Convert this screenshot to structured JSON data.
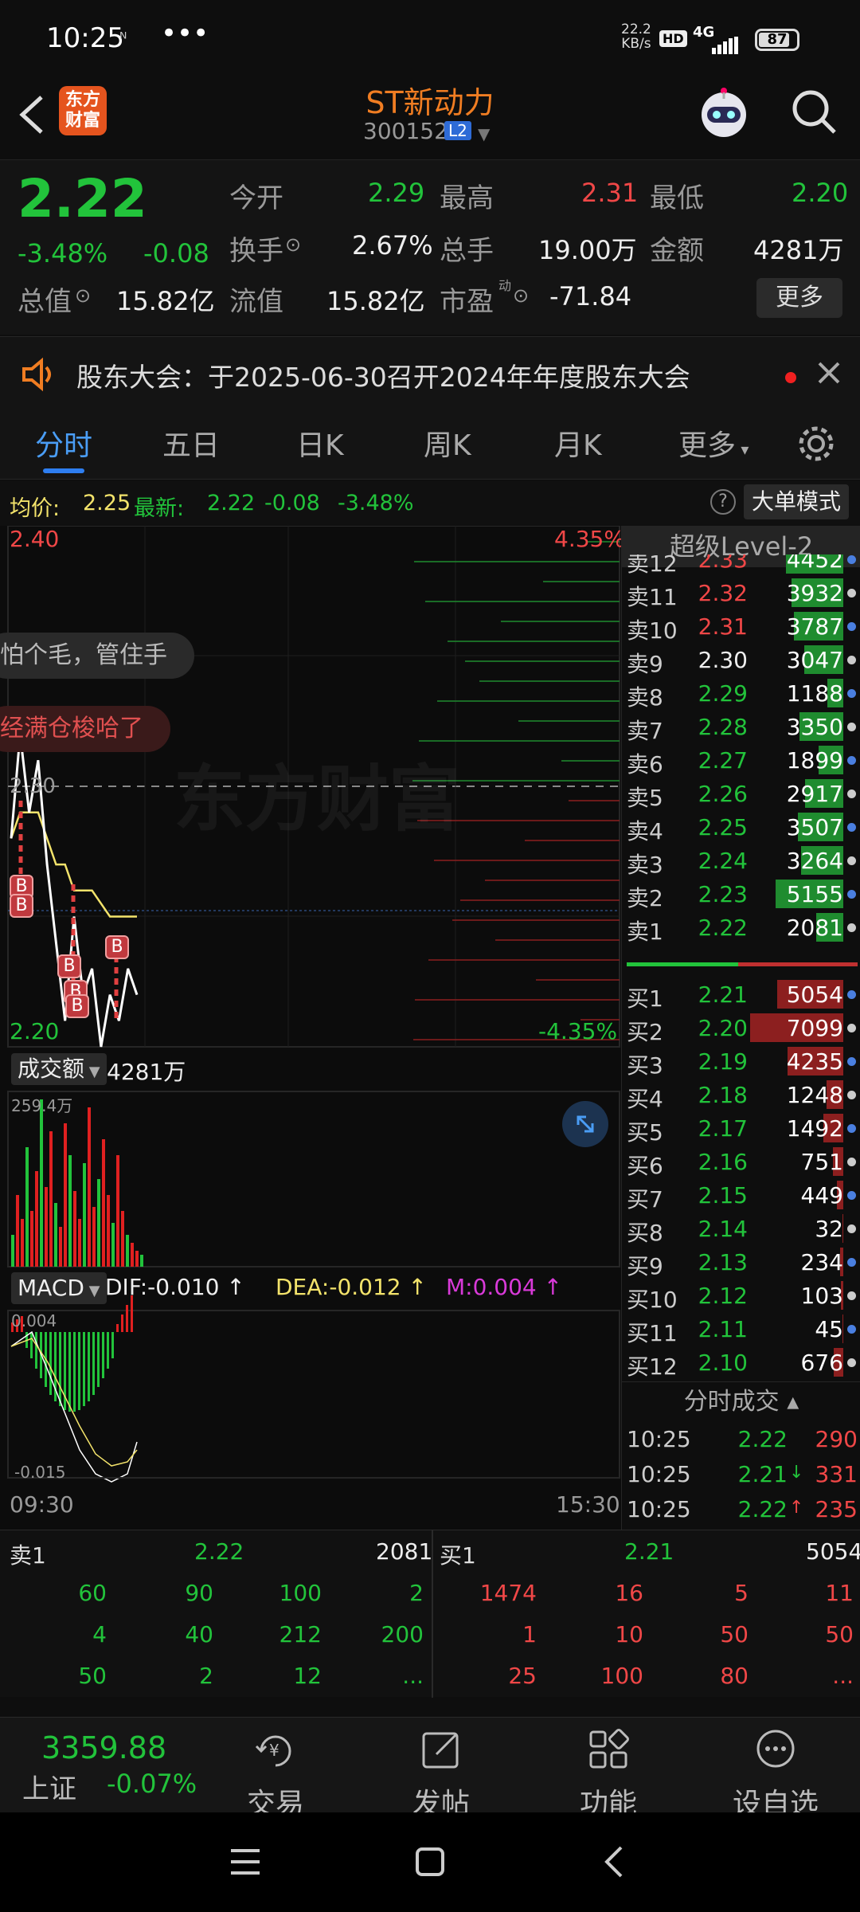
{
  "status_bar": {
    "time": "10:25",
    "net_speed_value": "22.2",
    "net_speed_unit": "KB/s",
    "hd": "HD",
    "network": "4G",
    "battery": "87"
  },
  "header": {
    "app_badge": "东方财富",
    "stock_name": "ST新动力",
    "stock_code": "300152",
    "level_badge": "L2"
  },
  "quote": {
    "price": "2.22",
    "change_pct": "-3.48%",
    "change": "-0.08",
    "open_label": "今开",
    "open": "2.29",
    "high_label": "最高",
    "high": "2.31",
    "low_label": "最低",
    "low": "2.20",
    "turnover_label": "换手",
    "turnover": "2.67%",
    "volume_label": "总手",
    "volume": "19.00万",
    "amount_label": "金额",
    "amount": "4281万",
    "total_cap_label": "总值",
    "total_cap": "15.82亿",
    "float_cap_label": "流值",
    "float_cap": "15.82亿",
    "pe_label": "市盈",
    "pe_sup": "动",
    "pe": "-71.84",
    "more_button": "更多"
  },
  "notice": {
    "text": "股东大会：于2025-06-30召开2024年年度股东大会"
  },
  "tabs": [
    "分时",
    "五日",
    "日K",
    "周K",
    "月K",
    "更多"
  ],
  "avg_bar": {
    "avg_label": "均价:",
    "avg": "2.25",
    "latest_label": "最新:",
    "latest": "2.22",
    "change": "-0.08",
    "change_pct": "-3.48%",
    "mode_button": "大单模式"
  },
  "chart": {
    "y_top": "2.40",
    "y_bottom": "2.20",
    "y_mid": "2.30",
    "pct_top": "4.35%",
    "pct_bottom": "-4.35%",
    "watermark": "东方财富",
    "danmaku": [
      "怕个毛，管住手",
      "经满仓梭哈了"
    ],
    "trade_markers": [
      "B",
      "B",
      "B",
      "B",
      "B",
      "B"
    ],
    "volume_label": "成交额",
    "volume_value": "4281万",
    "volume_max": "259.4万",
    "macd_label": "MACD",
    "dif": "DIF:-0.010",
    "dea": "DEA:-0.012",
    "m": "M:0.004",
    "macd_top": "0.004",
    "macd_bottom": "-0.015",
    "time_start": "09:30",
    "time_end": "15:30"
  },
  "chart_data": {
    "type": "line",
    "title": "",
    "ylim": [
      2.2,
      2.4
    ],
    "series": [
      {
        "name": "",
        "values": [
          2.28,
          2.32,
          2.29,
          2.31,
          2.27,
          2.24,
          2.21,
          2.25,
          2.22,
          2.23,
          2.2,
          2.22,
          2.21,
          2.23,
          2.22
        ]
      },
      {
        "name": "",
        "values": [
          2.28,
          2.29,
          2.29,
          2.29,
          2.28,
          2.27,
          2.27,
          2.26,
          2.26,
          2.26,
          2.255,
          2.25,
          2.25,
          2.25,
          2.25
        ]
      }
    ]
  },
  "book": {
    "header": "超级Level-2",
    "sells": [
      {
        "label": "卖12",
        "price": "2.33",
        "vol": "4452",
        "fill": 0.55
      },
      {
        "label": "卖11",
        "price": "2.32",
        "vol": "3932",
        "fill": 0.5
      },
      {
        "label": "卖10",
        "price": "2.31",
        "vol": "3787",
        "fill": 0.48
      },
      {
        "label": "卖9",
        "price": "2.30",
        "vol": "3047",
        "fill": 0.38
      },
      {
        "label": "卖8",
        "price": "2.29",
        "vol": "1188",
        "fill": 0.15
      },
      {
        "label": "卖7",
        "price": "2.28",
        "vol": "3350",
        "fill": 0.42
      },
      {
        "label": "卖6",
        "price": "2.27",
        "vol": "1899",
        "fill": 0.24
      },
      {
        "label": "卖5",
        "price": "2.26",
        "vol": "2917",
        "fill": 0.37
      },
      {
        "label": "卖4",
        "price": "2.25",
        "vol": "3507",
        "fill": 0.44
      },
      {
        "label": "卖3",
        "price": "2.24",
        "vol": "3264",
        "fill": 0.41
      },
      {
        "label": "卖2",
        "price": "2.23",
        "vol": "5155",
        "fill": 0.65
      },
      {
        "label": "卖1",
        "price": "2.22",
        "vol": "2081",
        "fill": 0.26
      }
    ],
    "buys": [
      {
        "label": "买1",
        "price": "2.21",
        "vol": "5054",
        "fill": 0.64
      },
      {
        "label": "买2",
        "price": "2.20",
        "vol": "7099",
        "fill": 0.9
      },
      {
        "label": "买3",
        "price": "2.19",
        "vol": "4235",
        "fill": 0.54
      },
      {
        "label": "买4",
        "price": "2.18",
        "vol": "1248",
        "fill": 0.16
      },
      {
        "label": "买5",
        "price": "2.17",
        "vol": "1492",
        "fill": 0.19
      },
      {
        "label": "买6",
        "price": "2.16",
        "vol": "751",
        "fill": 0.1
      },
      {
        "label": "买7",
        "price": "2.15",
        "vol": "449",
        "fill": 0.06
      },
      {
        "label": "买8",
        "price": "2.14",
        "vol": "32",
        "fill": 0.01
      },
      {
        "label": "买9",
        "price": "2.13",
        "vol": "234",
        "fill": 0.03
      },
      {
        "label": "买10",
        "price": "2.12",
        "vol": "103",
        "fill": 0.02
      },
      {
        "label": "买11",
        "price": "2.11",
        "vol": "45",
        "fill": 0.01
      },
      {
        "label": "买12",
        "price": "2.10",
        "vol": "676",
        "fill": 0.09
      }
    ],
    "ticks_header": "分时成交",
    "ticks": [
      {
        "time": "10:25",
        "price": "2.22",
        "arrow": "",
        "vol": "290"
      },
      {
        "time": "10:25",
        "price": "2.21",
        "arrow": "↓",
        "vol": "331"
      },
      {
        "time": "10:25",
        "price": "2.22",
        "arrow": "↑",
        "vol": "235"
      }
    ]
  },
  "bottom_table": {
    "sell_label": "卖1",
    "sell_price": "2.22",
    "sell_vol": "2081",
    "buy_label": "买1",
    "buy_price": "2.21",
    "buy_vol": "5054",
    "sell_rows": [
      [
        "60",
        "90",
        "100",
        "2"
      ],
      [
        "4",
        "40",
        "212",
        "200"
      ],
      [
        "50",
        "2",
        "12",
        "..."
      ]
    ],
    "buy_rows": [
      [
        "1474",
        "16",
        "5",
        "11"
      ],
      [
        "1",
        "10",
        "50",
        "50"
      ],
      [
        "25",
        "100",
        "80",
        "..."
      ]
    ]
  },
  "nav": {
    "index_value": "3359.88",
    "index_name": "上证",
    "index_change": "-0.07%",
    "items": [
      "交易",
      "发帖",
      "功能",
      "设自选"
    ]
  }
}
